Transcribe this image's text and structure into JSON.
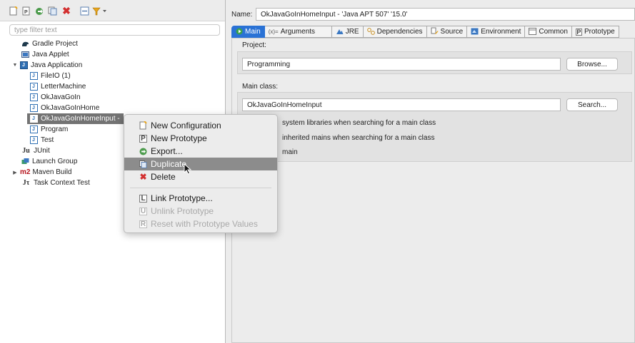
{
  "toolbar": {
    "icons": [
      "new-launch-configuration-icon",
      "new-prototype-icon",
      "export-icon",
      "duplicate-icon",
      "delete-icon",
      "collapse-all-icon",
      "filter-icon"
    ]
  },
  "filter": {
    "placeholder": "type filter text"
  },
  "tree": {
    "items": [
      {
        "label": "Gradle Project",
        "icon": "gradle-icon"
      },
      {
        "label": "Java Applet",
        "icon": "applet-icon"
      },
      {
        "label": "Java Application",
        "icon": "java-application-icon",
        "expanded": true
      },
      {
        "label": "FileIO (1)"
      },
      {
        "label": "LetterMachine"
      },
      {
        "label": "OkJavaGoIn"
      },
      {
        "label": "OkJavaGoInHome"
      },
      {
        "label": "OkJavaGoInHomeInput -"
      },
      {
        "label": "Program"
      },
      {
        "label": "Test"
      },
      {
        "label": "JUnit",
        "icon": "junit-icon"
      },
      {
        "label": "Launch Group",
        "icon": "launch-group-icon"
      },
      {
        "label": "Maven Build",
        "icon": "maven-icon",
        "prefix": "m2"
      },
      {
        "label": "Task Context Test",
        "icon": "task-context-icon"
      }
    ]
  },
  "name": {
    "label": "Name:",
    "value": "OkJavaGoInHomeInput - 'Java APT 507' '15.0'"
  },
  "tabs": [
    {
      "label": "Main",
      "icon": "main-icon",
      "active": true
    },
    {
      "label": "Arguments",
      "icon": "arguments-icon",
      "prefix": "(x)="
    },
    {
      "label": "JRE",
      "icon": "jre-icon"
    },
    {
      "label": "Dependencies",
      "icon": "dependencies-icon"
    },
    {
      "label": "Source",
      "icon": "source-icon"
    },
    {
      "label": "Environment",
      "icon": "environment-icon"
    },
    {
      "label": "Common",
      "icon": "common-icon"
    },
    {
      "label": "Prototype",
      "icon": "prototype-icon"
    }
  ],
  "main": {
    "project_label": "Project:",
    "project_value": "Programming",
    "browse_label": "Browse...",
    "main_class_label": "Main class:",
    "main_class_value": "OkJavaGoInHomeInput",
    "search_label": "Search...",
    "option1": "system libraries when searching for a main class",
    "option2": "inherited mains when searching for a main class",
    "option3": "main"
  },
  "menu": {
    "items": [
      {
        "label": "New Configuration",
        "icon": "new-configuration-icon",
        "enabled": true
      },
      {
        "label": "New Prototype",
        "icon": "new-prototype-icon",
        "enabled": true
      },
      {
        "label": "Export...",
        "icon": "export-icon",
        "enabled": true
      },
      {
        "label": "Duplicate",
        "icon": "duplicate-icon",
        "enabled": true,
        "highlighted": true
      },
      {
        "label": "Delete",
        "icon": "delete-icon",
        "enabled": true
      },
      {
        "label": "Link Prototype...",
        "icon": "link-prototype-icon",
        "enabled": true
      },
      {
        "label": "Unlink Prototype",
        "icon": "unlink-prototype-icon",
        "enabled": false
      },
      {
        "label": "Reset with Prototype Values",
        "icon": "reset-prototype-icon",
        "enabled": false
      }
    ]
  },
  "colors": {
    "active_tab": "#2a72d5",
    "selection": "#737373",
    "delete_red": "#d32f2f"
  }
}
